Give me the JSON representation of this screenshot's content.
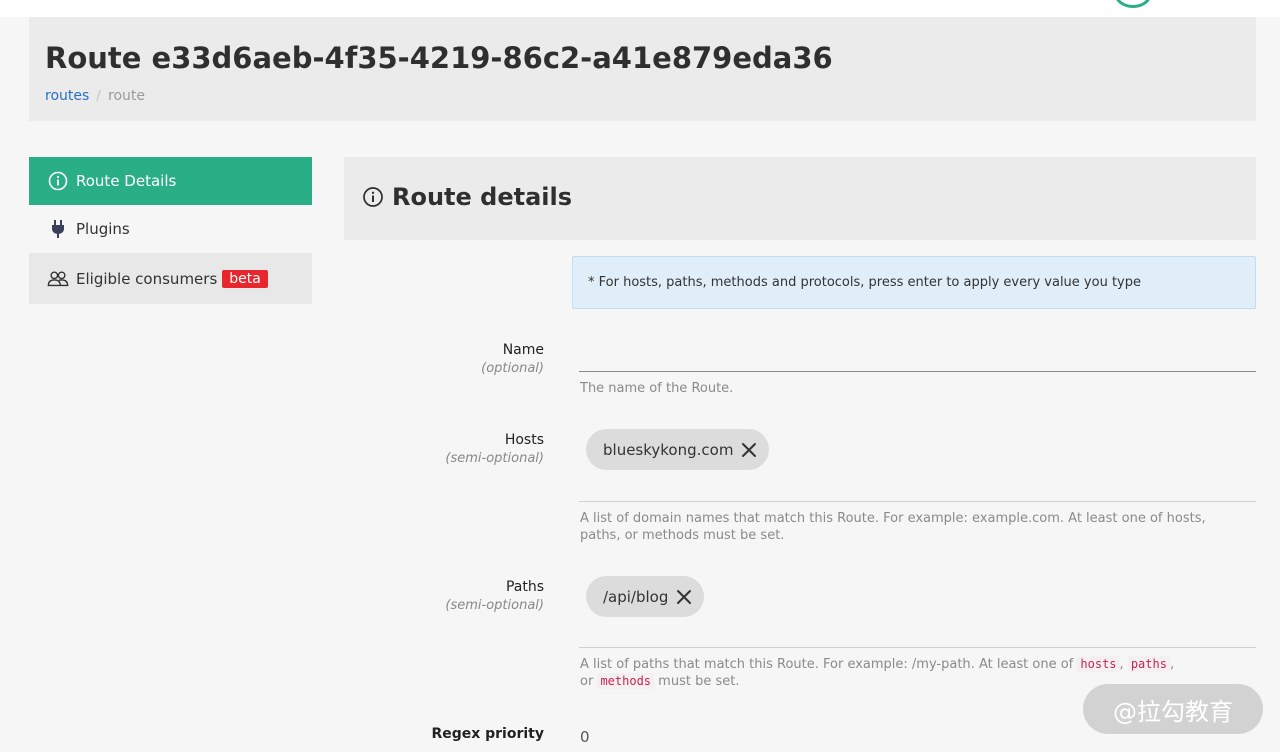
{
  "header": {
    "title": "Route e33d6aeb-4f35-4219-86c2-a41e879eda36",
    "breadcrumb": {
      "link": "routes",
      "separator": "/",
      "current": "route"
    }
  },
  "sidebar": {
    "items": [
      {
        "label": "Route Details",
        "icon": "info-icon",
        "active": true
      },
      {
        "label": "Plugins",
        "icon": "plug-icon"
      },
      {
        "label": "Eligible consumers",
        "icon": "users-icon",
        "badge": "beta"
      }
    ]
  },
  "content": {
    "title": "Route details",
    "info": "* For hosts, paths, methods and protocols, press enter to apply every value you type"
  },
  "form": {
    "name": {
      "label": "Name",
      "sub": "(optional)",
      "value": "",
      "help": "The name of the Route."
    },
    "hosts": {
      "label": "Hosts",
      "sub": "(semi-optional)",
      "tags": [
        "blueskykong.com"
      ],
      "help": "A list of domain names that match this Route. For example: example.com. At least one of hosts, paths, or methods must be set."
    },
    "paths": {
      "label": "Paths",
      "sub": "(semi-optional)",
      "tags": [
        "/api/blog"
      ],
      "help_prefix": "A list of paths that match this Route. For example: /my-path. At least one of",
      "help_code1": "hosts",
      "help_comma1": ",",
      "help_code2": "paths",
      "help_comma2": ",",
      "help_or": "or",
      "help_code3": "methods",
      "help_suffix": "must be set."
    },
    "regex_priority": {
      "label": "Regex priority",
      "value": "0"
    }
  },
  "watermark": "@拉勾教育",
  "colors": {
    "accent": "#2aae86",
    "badge": "#e8262d",
    "link": "#2a6fc7"
  }
}
